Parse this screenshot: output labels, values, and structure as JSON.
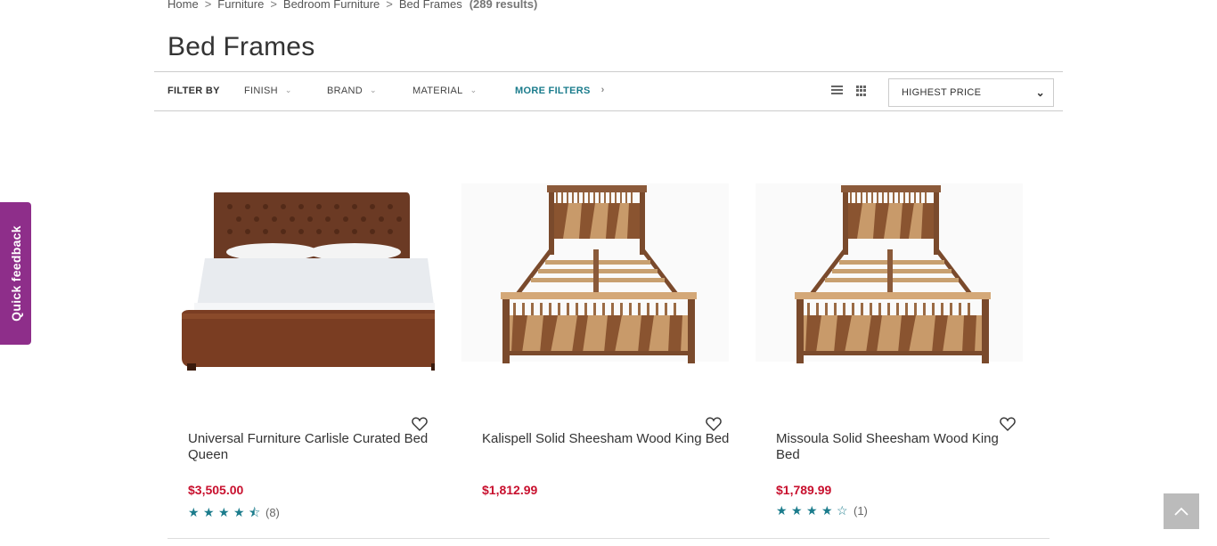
{
  "breadcrumb": {
    "items": [
      "Home",
      "Furniture",
      "Bedroom Furniture",
      "Bed Frames"
    ],
    "separator": ">",
    "count": "(289 results)"
  },
  "page_title": "Bed Frames",
  "filters": {
    "label": "FILTER BY",
    "items": [
      "FINISH",
      "BRAND",
      "MATERIAL"
    ],
    "more": "MORE FILTERS"
  },
  "sort": {
    "selected": "HIGHEST PRICE"
  },
  "products": [
    {
      "name": "Universal Furniture Carlisle Curated Bed Queen",
      "price": "$3,505.00",
      "rating": 4.5,
      "review_count": "(8)",
      "image_icon": "leather-bed-image"
    },
    {
      "name": "Kalispell Solid Sheesham Wood King Bed",
      "price": "$1,812.99",
      "rating": null,
      "review_count": "",
      "image_icon": "wood-bed-image"
    },
    {
      "name": "Missoula Solid Sheesham Wood King Bed",
      "price": "$1,789.99",
      "rating": 4,
      "review_count": "(1)",
      "image_icon": "wood-bed-image"
    }
  ],
  "feedback_tab": "Quick feedback",
  "colors": {
    "accent": "#1b7c8c",
    "price": "#c8102e",
    "feedback": "#8e2e8a"
  }
}
